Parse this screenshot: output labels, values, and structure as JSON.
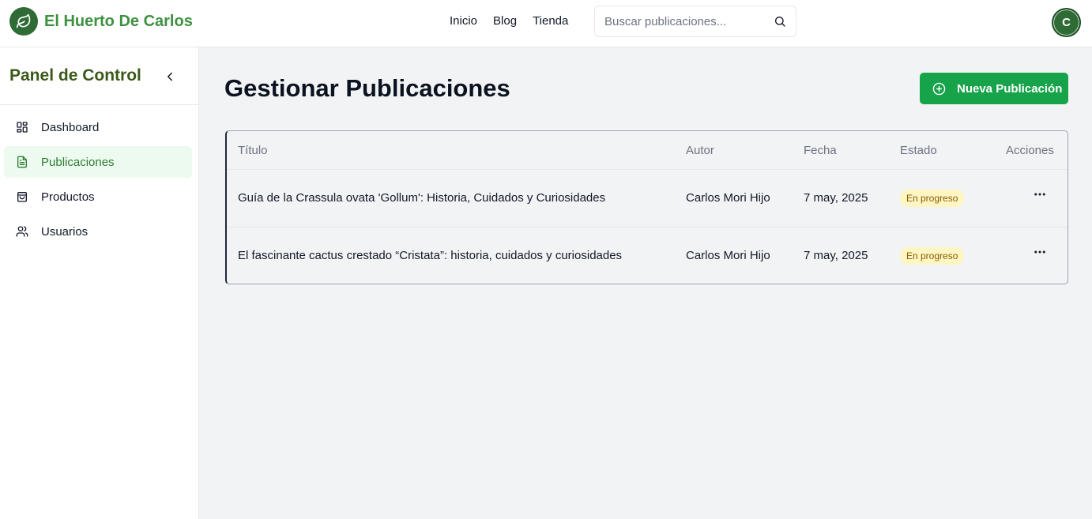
{
  "header": {
    "brand": "El Huerto De Carlos",
    "nav": [
      "Inicio",
      "Blog",
      "Tienda"
    ],
    "search_placeholder": "Buscar publicaciones...",
    "avatar_initial": "C"
  },
  "sidebar": {
    "title": "Panel de Control",
    "items": [
      {
        "label": "Dashboard",
        "icon": "grid-icon"
      },
      {
        "label": "Publicaciones",
        "icon": "document-icon",
        "active": true
      },
      {
        "label": "Productos",
        "icon": "shopping-bag-icon"
      },
      {
        "label": "Usuarios",
        "icon": "users-icon"
      }
    ]
  },
  "main": {
    "title": "Gestionar Publicaciones",
    "new_button": "Nueva Publicación",
    "table": {
      "columns": [
        "Título",
        "Autor",
        "Fecha",
        "Estado",
        "Acciones"
      ],
      "rows": [
        {
          "title": "Guía de la Crassula ovata 'Gollum': Historia, Cuidados y Curiosidades",
          "author": "Carlos Mori Hijo",
          "date": "7 may, 2025",
          "status": "En progreso"
        },
        {
          "title": "El fascinante cactus crestado “Cristata”: historia, cuidados y curiosidades",
          "author": "Carlos Mori Hijo",
          "date": "7 may, 2025",
          "status": "En progreso"
        }
      ]
    }
  },
  "colors": {
    "brand_green": "#3d9140",
    "primary_button": "#16a34a",
    "status_badge_bg": "#fdf6c3",
    "active_item_bg": "#edfaef"
  }
}
